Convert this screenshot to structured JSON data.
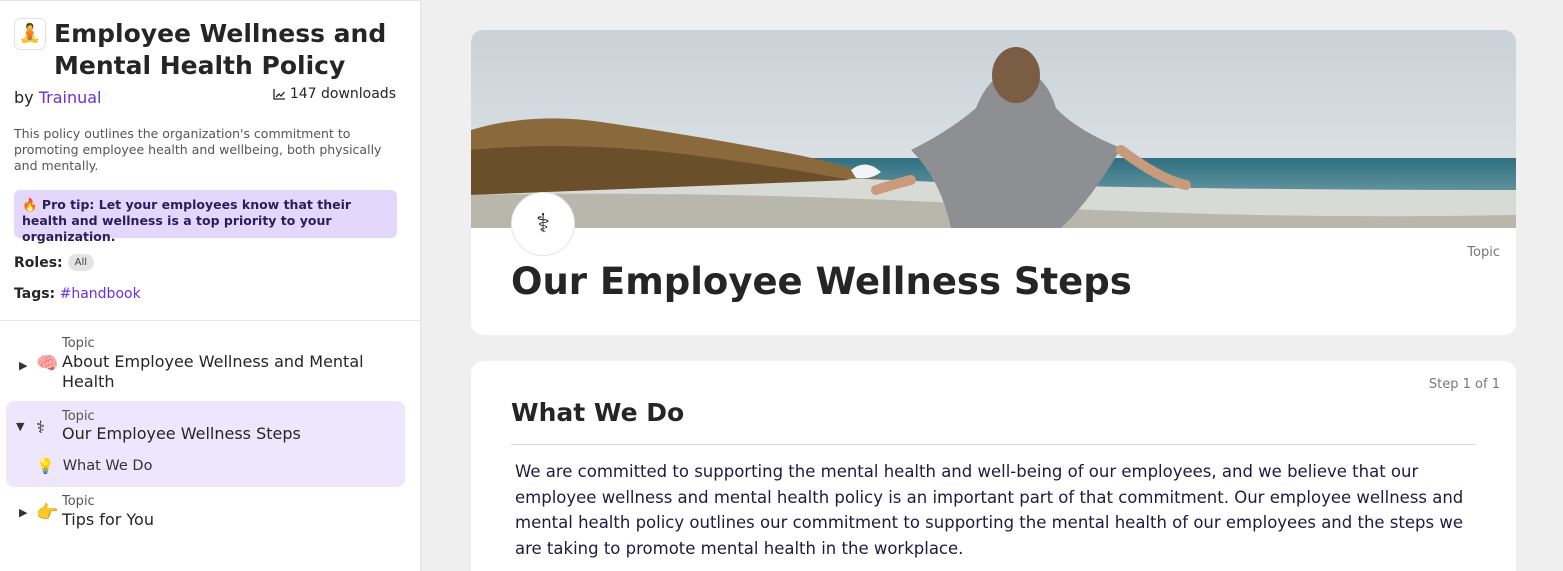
{
  "sidebar": {
    "title_emoji": "🧘",
    "title": "Employee Wellness and Mental Health Policy",
    "by_prefix": "by",
    "author": "Trainual",
    "downloads": "147 downloads",
    "description": "This policy outlines the organization's commitment to promoting employee health and wellbeing, both physically and mentally.",
    "pro_tip": "🔥 Pro tip: Let your employees know that their health and wellness is a top priority to your organization.",
    "roles_label": "Roles:",
    "roles_value": "All",
    "tags_label": "Tags:",
    "tag": "#handbook",
    "topics": [
      {
        "kicker": "Topic",
        "emoji": "🧠",
        "title": "About Employee Wellness and Mental Health",
        "expanded": false
      },
      {
        "kicker": "Topic",
        "emoji": "⚕",
        "title": "Our Employee Wellness Steps",
        "expanded": true,
        "sub_items": [
          {
            "emoji": "💡",
            "label": "What We Do"
          }
        ]
      },
      {
        "kicker": "Topic",
        "emoji": "👉",
        "title": "Tips for You",
        "expanded": false
      }
    ]
  },
  "main": {
    "badge_icon": "⚕",
    "topic_label": "Topic",
    "title": "Our Employee Wellness Steps",
    "step": {
      "counter": "Step 1 of 1",
      "title": "What We Do",
      "body": "We are committed to supporting the mental health and well-being of our employees, and we believe that our employee wellness and mental health policy is an important part of that commitment. Our employee wellness and mental health policy outlines our commitment to supporting the mental health of our employees and the steps we are taking to promote mental health in the workplace."
    }
  },
  "colors": {
    "accent": "#6c2fd8",
    "protip_bg": "#e3d8fb",
    "active_topic_bg": "#ede6fd",
    "page_bg": "#efefef"
  }
}
